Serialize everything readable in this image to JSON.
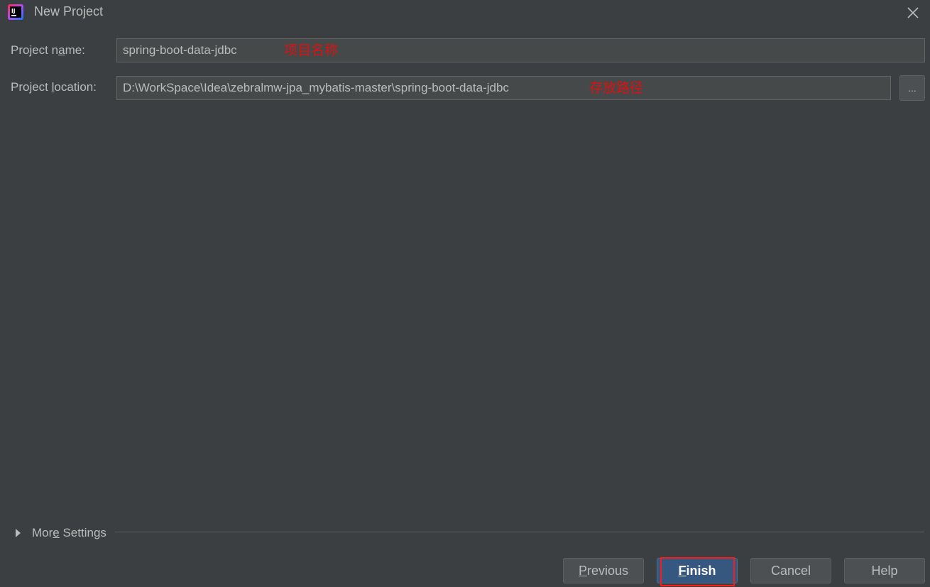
{
  "window": {
    "title": "New Project",
    "app_icon_text": "IJ"
  },
  "form": {
    "project_name": {
      "label_pre": "Project n",
      "label_mnemonic": "a",
      "label_post": "me:",
      "value": "spring-boot-data-jdbc",
      "annotation": "项目名称"
    },
    "project_location": {
      "label_pre": "Project ",
      "label_mnemonic": "l",
      "label_post": "ocation:",
      "value": "D:\\WorkSpace\\Idea\\zebralmw-jpa_mybatis-master\\spring-boot-data-jdbc",
      "annotation": "存放路径",
      "browse_label": "..."
    }
  },
  "more_settings": {
    "label_pre": "Mor",
    "label_mnemonic": "e",
    "label_post": " Settings"
  },
  "buttons": {
    "previous": {
      "mnemonic": "P",
      "rest": "revious"
    },
    "finish": {
      "mnemonic": "F",
      "rest": "inish"
    },
    "cancel": "Cancel",
    "help": "Help"
  },
  "colors": {
    "background": "#3c3f41",
    "field_background": "#45494a",
    "primary_button": "#365880",
    "annotation_red": "#e01010",
    "highlight_red": "#ff1a1a"
  }
}
